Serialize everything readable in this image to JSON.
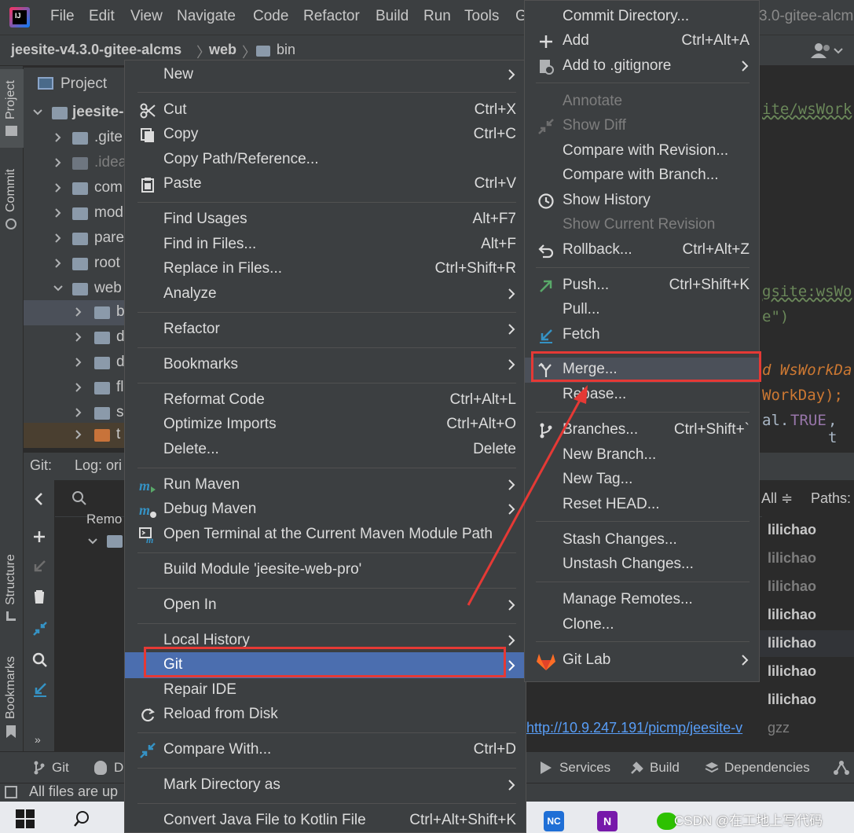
{
  "menubar": {
    "items": [
      "File",
      "Edit",
      "View",
      "Navigate",
      "Code",
      "Refactor",
      "Build",
      "Run",
      "Tools",
      "G"
    ],
    "title_fragment": "3.0-gitee-alcm"
  },
  "breadcrumb": {
    "project": "jeesite-v4.3.0-gitee-alcms",
    "module": "web",
    "folder": "bin"
  },
  "left_tabs": {
    "project": "Project",
    "commit": "Commit",
    "structure": "Structure",
    "bookmarks": "Bookmarks"
  },
  "project_panel": {
    "title": "Project",
    "rows": [
      {
        "label": "jeesite-",
        "bold": true
      },
      {
        "label": ".gite"
      },
      {
        "label": ".idea",
        "dim": true
      },
      {
        "label": "com"
      },
      {
        "label": "mod"
      },
      {
        "label": "pare"
      },
      {
        "label": "root"
      },
      {
        "label": "web"
      },
      {
        "label": "b"
      },
      {
        "label": "d"
      },
      {
        "label": "d"
      },
      {
        "label": "fl"
      },
      {
        "label": "s"
      },
      {
        "label": "t"
      }
    ]
  },
  "editor_fragments": {
    "line1": "ite/wsWork",
    "line2": "gsite:wsWo",
    "line3": "e\")",
    "line4": "d WsWorkDa",
    "line5": "WorkDay);",
    "line6a": "al.",
    "line6b": "TRUE",
    "line6c": ", t"
  },
  "git_panel": {
    "tab_git": "Git:",
    "tab_log": "Log: ori",
    "tree_label": "Remo",
    "filter_user": "e: All ≑",
    "filter_paths": "Paths:",
    "authors": [
      "lilichao",
      "lilichao",
      "lilichao",
      "lilichao",
      "lilichao",
      "lilichao",
      "lilichao"
    ],
    "link": "http://10.9.247.191/picmp/jeesite-v",
    "link_suffix": "gzz"
  },
  "bottom_tools": {
    "git": "Git",
    "debug": "D",
    "services": "Services",
    "build": "Build",
    "dependencies": "Dependencies"
  },
  "status_bar": {
    "text": "All files are up"
  },
  "watermark": "CSDN @在工地上写代码",
  "context_menu": {
    "items": [
      {
        "label": "New"
      },
      {
        "label": "Cut",
        "shortcut": "Ctrl+X"
      },
      {
        "label": "Copy",
        "shortcut": "Ctrl+C"
      },
      {
        "label": "Copy Path/Reference..."
      },
      {
        "label": "Paste",
        "shortcut": "Ctrl+V"
      },
      {
        "label": "Find Usages",
        "shortcut": "Alt+F7"
      },
      {
        "label": "Find in Files...",
        "shortcut": "Alt+F"
      },
      {
        "label": "Replace in Files...",
        "shortcut": "Ctrl+Shift+R"
      },
      {
        "label": "Analyze"
      },
      {
        "label": "Refactor"
      },
      {
        "label": "Bookmarks"
      },
      {
        "label": "Reformat Code",
        "shortcut": "Ctrl+Alt+L"
      },
      {
        "label": "Optimize Imports",
        "shortcut": "Ctrl+Alt+O"
      },
      {
        "label": "Delete...",
        "shortcut": "Delete"
      },
      {
        "label": "Run Maven"
      },
      {
        "label": "Debug Maven"
      },
      {
        "label": "Open Terminal at the Current Maven Module Path"
      },
      {
        "label": "Build Module 'jeesite-web-pro'"
      },
      {
        "label": "Open In"
      },
      {
        "label": "Local History"
      },
      {
        "label": "Git"
      },
      {
        "label": "Repair IDE"
      },
      {
        "label": "Reload from Disk"
      },
      {
        "label": "Compare With...",
        "shortcut": "Ctrl+D"
      },
      {
        "label": "Mark Directory as"
      },
      {
        "label": "Convert Java File to Kotlin File",
        "shortcut": "Ctrl+Alt+Shift+K"
      }
    ]
  },
  "git_submenu": {
    "items": [
      {
        "label": "Commit Directory..."
      },
      {
        "label": "Add",
        "shortcut": "Ctrl+Alt+A"
      },
      {
        "label": "Add to .gitignore"
      },
      {
        "label": "Annotate"
      },
      {
        "label": "Show Diff"
      },
      {
        "label": "Compare with Revision..."
      },
      {
        "label": "Compare with Branch..."
      },
      {
        "label": "Show History"
      },
      {
        "label": "Show Current Revision"
      },
      {
        "label": "Rollback...",
        "shortcut": "Ctrl+Alt+Z"
      },
      {
        "label": "Push...",
        "shortcut": "Ctrl+Shift+K"
      },
      {
        "label": "Pull..."
      },
      {
        "label": "Fetch"
      },
      {
        "label": "Merge..."
      },
      {
        "label": "Rebase..."
      },
      {
        "label": "Branches...",
        "shortcut": "Ctrl+Shift+`"
      },
      {
        "label": "New Branch..."
      },
      {
        "label": "New Tag..."
      },
      {
        "label": "Reset HEAD..."
      },
      {
        "label": "Stash Changes..."
      },
      {
        "label": "Unstash Changes..."
      },
      {
        "label": "Manage Remotes..."
      },
      {
        "label": "Clone..."
      },
      {
        "label": "Git Lab"
      }
    ]
  },
  "colors": {
    "highlight_box": "#e53935",
    "selection": "#4b6eaf",
    "menu_bg": "#3c3f41",
    "link": "#589df6",
    "string_green": "#6a8759"
  }
}
